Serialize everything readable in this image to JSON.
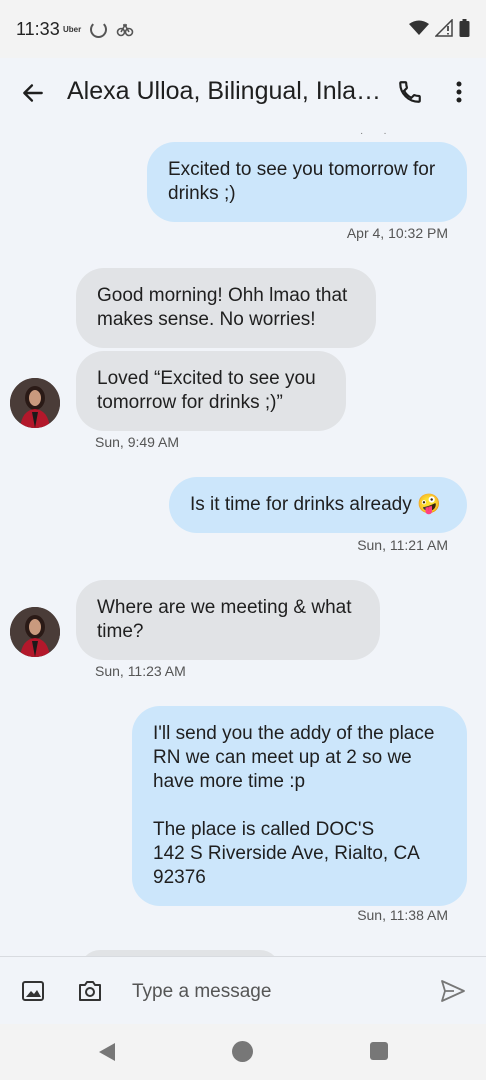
{
  "status_bar": {
    "time": "11:33",
    "app_label": "Uber"
  },
  "header": {
    "title": "Alexa Ulloa, Bilingual, Inla…"
  },
  "messages": [
    {
      "direction": "out",
      "text": "Excited to see you tomorrow for\ndrinks ;)",
      "timestamp": "Apr 4, 10:32 PM"
    },
    {
      "direction": "in",
      "text": "Good morning! Ohh lmao that\nmakes sense. No worries!",
      "timestamp": ""
    },
    {
      "direction": "in",
      "text": "Loved “Excited to see you\ntomorrow for drinks ;)”",
      "timestamp": "Sun, 9:49 AM"
    },
    {
      "direction": "out",
      "text": "Is it time for drinks already 🤪",
      "timestamp": "Sun, 11:21 AM"
    },
    {
      "direction": "in",
      "text": "Where are we meeting & what\ntime?",
      "timestamp": "Sun, 11:23 AM"
    },
    {
      "direction": "out",
      "text": "I'll send you the addy of the place\nRN we can meet up at 2 so we\nhave more time :p\n\nThe place is called DOC'S\n142 S Riverside Ave, Rialto, CA\n92376",
      "timestamp": "Sun, 11:38 AM"
    }
  ],
  "compose": {
    "placeholder": "Type a message"
  },
  "colors": {
    "outgoing_bubble": "#cce6fb",
    "incoming_bubble": "#e1e3e6",
    "background": "#f1f4f9"
  },
  "icons": [
    "back-arrow-icon",
    "phone-icon",
    "more-vert-icon",
    "gallery-icon",
    "camera-icon",
    "send-icon"
  ]
}
